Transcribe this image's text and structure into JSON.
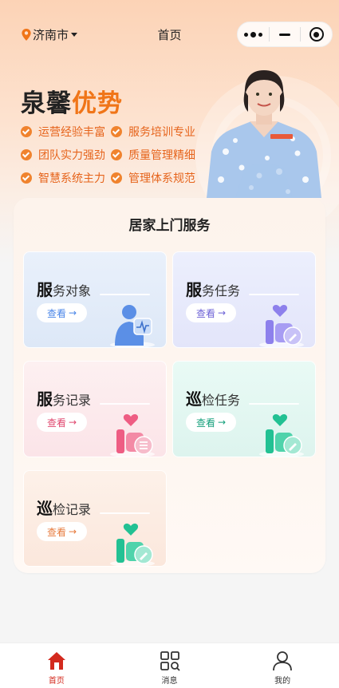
{
  "header": {
    "location": "济南市",
    "title": "首页"
  },
  "hero": {
    "slogan_main": "泉馨",
    "slogan_accent": "优势",
    "features": [
      "运营经验丰富",
      "服务培训专业",
      "团队实力强劲",
      "质量管理精细",
      "智慧系统主力",
      "管理体系规范"
    ]
  },
  "services": {
    "title": "居家上门服务",
    "tiles": [
      {
        "lead": "服",
        "rest": "务对象",
        "view": "查看",
        "color": "#4a86e8",
        "icon": "elderly-person-icon"
      },
      {
        "lead": "服",
        "rest": "务任务",
        "view": "查看",
        "color": "#7a6ee0",
        "icon": "care-task-icon"
      },
      {
        "lead": "服",
        "rest": "务记录",
        "view": "查看",
        "color": "#e5527a",
        "icon": "service-record-icon"
      },
      {
        "lead": "巡",
        "rest": "检任务",
        "view": "查看",
        "color": "#1fb08a",
        "icon": "inspection-task-icon"
      },
      {
        "lead": "巡",
        "rest": "检记录",
        "view": "查看",
        "color": "#e77a3c",
        "icon": "inspection-record-icon"
      }
    ]
  },
  "tabbar": {
    "items": [
      {
        "label": "首页",
        "active": true,
        "icon": "home-icon"
      },
      {
        "label": "消息",
        "active": false,
        "icon": "message-icon"
      },
      {
        "label": "我的",
        "active": false,
        "icon": "profile-icon"
      }
    ],
    "active_color": "#d32a1e"
  }
}
